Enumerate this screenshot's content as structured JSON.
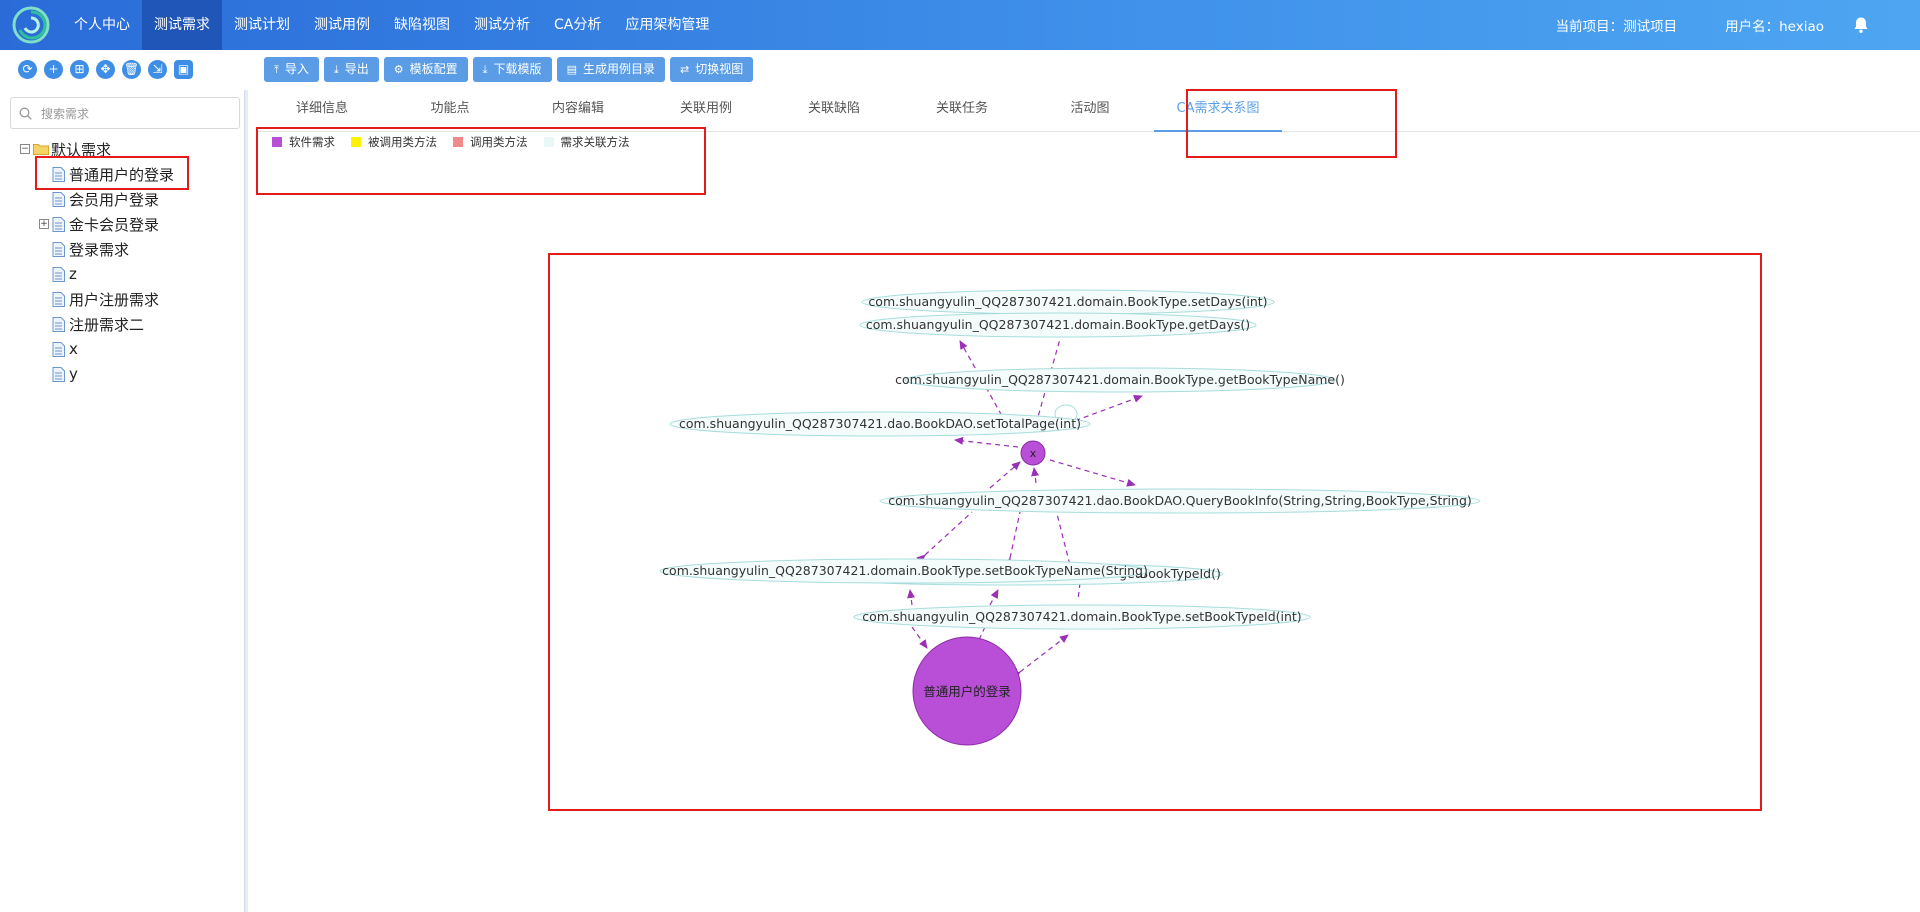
{
  "nav": {
    "items": [
      "个人中心",
      "测试需求",
      "测试计划",
      "测试用例",
      "缺陷视图",
      "测试分析",
      "CA分析",
      "应用架构管理"
    ],
    "active_index": 1,
    "current_project": "当前项目：测试项目",
    "username": "用户名：hexiao"
  },
  "toolbar": {
    "import": "导入",
    "export": "导出",
    "template_config": "模板配置",
    "download_template": "下载模版",
    "generate_case_dir": "生成用例目录",
    "switch_view": "切换视图"
  },
  "sidebar": {
    "search_placeholder": "搜索需求",
    "root": "默认需求",
    "items": [
      "普通用户的登录",
      "会员用户登录",
      "金卡会员登录",
      "登录需求",
      "z",
      "用户注册需求",
      "注册需求二",
      "x",
      "y"
    ]
  },
  "tabs": [
    "详细信息",
    "功能点",
    "内容编辑",
    "关联用例",
    "关联缺陷",
    "关联任务",
    "活动图",
    "CA需求关系图"
  ],
  "active_tab_index": 7,
  "legend": [
    {
      "label": "软件需求",
      "color": "#b84fd6"
    },
    {
      "label": "被调用类方法",
      "color": "#fff200"
    },
    {
      "label": "调用类方法",
      "color": "#f08a8a"
    },
    {
      "label": "需求关联方法",
      "color": "#e8f7f7"
    }
  ],
  "graph": {
    "nodes": {
      "setDays": "com.shuangyulin_QQ287307421.domain.BookType.setDays(int)",
      "getDays": "com.shuangyulin_QQ287307421.domain.BookType.getDays()",
      "getBookTypeName": "com.shuangyulin_QQ287307421.domain.BookType.getBookTypeName()",
      "setTotalPage": "com.shuangyulin_QQ287307421.dao.BookDAO.setTotalPage(int)",
      "x": "x",
      "queryBookInfo": "com.shuangyulin_QQ287307421.dao.BookDAO.QueryBookInfo(String,String,BookType,String)",
      "setBookTypeName": "com.shuangyulin_QQ287307421.domain.BookType.setBookTypeName(String)",
      "getBookTypeId_partial": "getBookTypeId()",
      "setBookTypeId": "com.shuangyulin_QQ287307421.domain.BookType.setBookTypeId(int)",
      "requirement": "普通用户的登录"
    },
    "colors": {
      "requirement": "#b84fd6",
      "edge": "#9b2fb5",
      "method_fill": "#f4fbfb",
      "method_stroke": "#a8dcdc"
    }
  }
}
